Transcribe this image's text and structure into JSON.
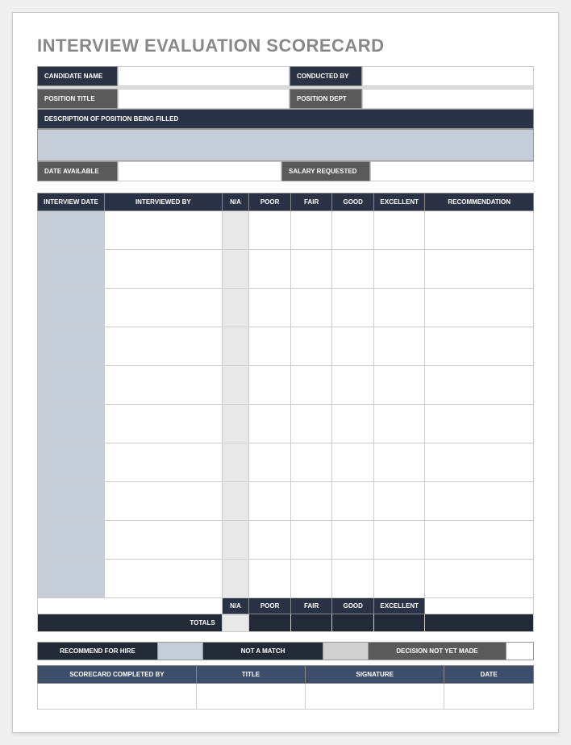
{
  "title": "INTERVIEW EVALUATION SCORECARD",
  "fields": {
    "candidate_name": "CANDIDATE NAME",
    "conducted_by": "CONDUCTED BY",
    "position_title": "POSITION TITLE",
    "position_dept": "POSITION DEPT",
    "description": "DESCRIPTION OF POSITION BEING FILLED",
    "date_available": "DATE AVAILABLE",
    "salary_requested": "SALARY REQUESTED"
  },
  "table": {
    "headers": {
      "date": "INTERVIEW DATE",
      "by": "INTERVIEWED BY",
      "na": "N/A",
      "poor": "POOR",
      "fair": "FAIR",
      "good": "GOOD",
      "excellent": "EXCELLENT",
      "recommendation": "RECOMMENDATION"
    },
    "totals": "TOTALS"
  },
  "decision": {
    "recommend": "RECOMMEND FOR HIRE",
    "not_match": "NOT A MATCH",
    "not_yet": "DECISION NOT YET MADE"
  },
  "signature": {
    "completed_by": "SCORECARD COMPLETED BY",
    "title": "TITLE",
    "signature": "SIGNATURE",
    "date": "DATE"
  }
}
